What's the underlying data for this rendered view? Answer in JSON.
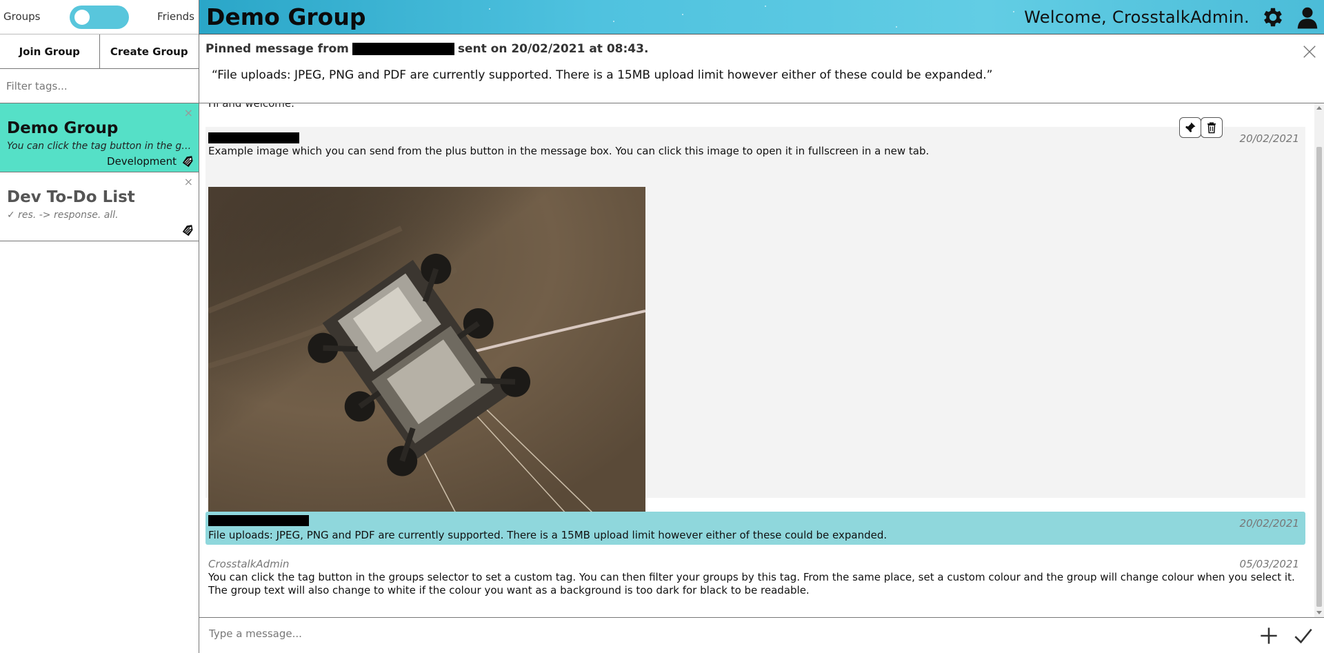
{
  "sidebar": {
    "toggle_left": "Groups",
    "toggle_right": "Friends",
    "join_label": "Join Group",
    "create_label": "Create Group",
    "filter_placeholder": "Filter tags...",
    "groups": [
      {
        "title": "Demo Group",
        "preview": "You can click the tag button in the groups selector to set a custom tag.",
        "tag": "Development",
        "close": "×"
      },
      {
        "title": "Dev To-Do List",
        "preview": "✓ res. -> response. all.",
        "tag": "",
        "close": "×"
      }
    ]
  },
  "header": {
    "title": "Demo Group",
    "welcome": "Welcome, CrosstalkAdmin."
  },
  "pinned": {
    "prefix": "Pinned message from",
    "suffix": "sent on 20/02/2021 at 08:43.",
    "body": "“File uploads: JPEG, PNG and PDF are currently supported. There is a 15MB upload limit however either of these could be expanded.”"
  },
  "messages": {
    "partial_text": "Hi and welcome.",
    "image_message": {
      "date": "20/02/2021",
      "text": "Example image which you can send from the plus button in the message box. You can click this image to open it in fullscreen in a new tab."
    },
    "pinned_message": {
      "date": "20/02/2021",
      "text": "File uploads: JPEG, PNG and PDF are currently supported. There is a 15MB upload limit however either of these could be expanded."
    },
    "last_message": {
      "author": "CrosstalkAdmin",
      "date": "05/03/2021",
      "text": "You can click the tag button in the groups selector to set a custom tag. You can then filter your groups by this tag. From the same place, set a custom colour and the group will change colour when you select it. The group text will also change to white if the colour you want as a background is too dark for black to be readable."
    }
  },
  "composer": {
    "placeholder": "Type a message..."
  },
  "colors": {
    "accent": "#58c6dc",
    "active_group": "#55e0c7",
    "pinned_highlight": "#8fd7dc",
    "message_bg": "#f3f3f3"
  },
  "icons": {
    "gear": "gear-icon",
    "user": "user-icon",
    "tag": "tag-icon",
    "pin": "pin-icon",
    "trash": "trash-icon",
    "plus": "plus-icon",
    "send": "checkmark-icon",
    "close": "close-icon"
  }
}
